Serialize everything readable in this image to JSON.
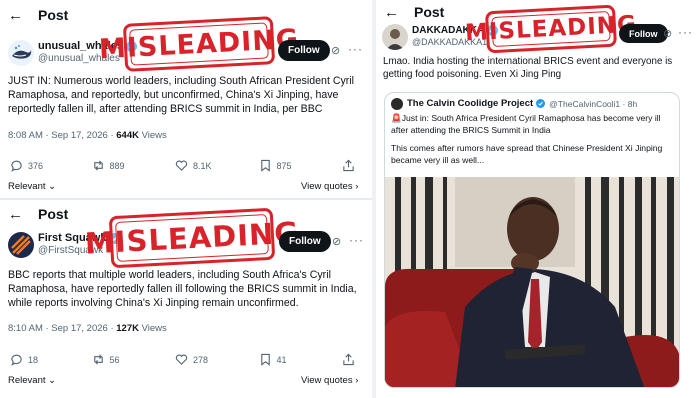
{
  "colors": {
    "stamp": "#d8232a",
    "follow_bg": "#0f1419",
    "verified": "#1d9bf0",
    "muted": "#536471"
  },
  "tweet1": {
    "header": {
      "back": "←",
      "title": "Post"
    },
    "author": "unusual_whales",
    "handle": "@unusual_whales",
    "follow": "Follow",
    "stamp": "MISLEADING",
    "text": "JUST IN: Numerous world leaders, including South African President Cyril Ramaphosa, and reportedly, but unconfirmed, China's Xi Jinping, have reportedly fallen ill, after attending BRICS summit in India, per BBC",
    "time": "8:08 AM · Sep 17, 2026 · ",
    "views": "644K",
    "views_label": " Views",
    "actions": {
      "replies": "376",
      "reposts": "889",
      "likes": "8.1K",
      "bookmarks": "875"
    },
    "relevant": "Relevant",
    "view_quotes": "View quotes"
  },
  "tweet2": {
    "header": {
      "back": "←",
      "title": "Post"
    },
    "author": "First Squawk",
    "handle": "@FirstSquawk",
    "follow": "Follow",
    "stamp": "MISLEADING",
    "text": "BBC reports that multiple world leaders, including South Africa's Cyril Ramaphosa, have reportedly fallen ill following the BRICS summit in India, while reports involving China's Xi Jinping remain unconfirmed.",
    "time": "8:10 AM · Sep 17, 2026 · ",
    "views": "127K",
    "views_label": " Views",
    "actions": {
      "replies": "18",
      "reposts": "56",
      "likes": "278",
      "bookmarks": "41"
    },
    "relevant": "Relevant",
    "view_quotes": "View quotes"
  },
  "tweet3": {
    "header": {
      "back": "←",
      "title": "Post"
    },
    "author": "DAKKADAKKA",
    "handle": "@DAKKADAKKA1",
    "follow": "Follow",
    "stamp": "MISLEADING",
    "text": "Lmao. India hosting the international BRICS event and everyone is getting food poisoning. Even Xi Jing Ping",
    "quote": {
      "author": "The Calvin Coolidge Project",
      "handle": "@TheCalvinCooli1 · 8h",
      "line1": "Just in: South Africa President Cyril Ramaphosa has become very ill after attending the BRICS Summit in India",
      "line2": "This comes after rumors have spread that Chinese President Xi Jinping became very ill as well..."
    }
  }
}
